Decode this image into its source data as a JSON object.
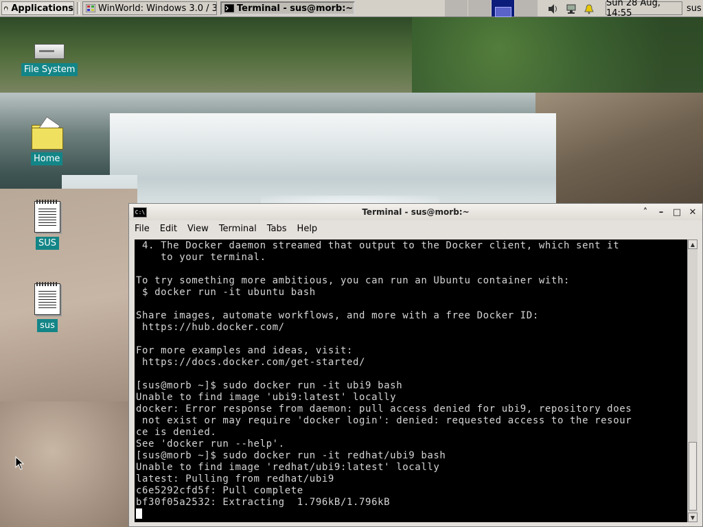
{
  "panel": {
    "applications_label": "Applications",
    "tasks": [
      {
        "label": "WinWorld: Windows 3.0 / 3...."
      },
      {
        "label": "Terminal - sus@morb:~"
      }
    ],
    "clock": "Sun 28 Aug, 14:55",
    "user": "sus",
    "icons": [
      "applications-icon",
      "winworld-icon",
      "terminal-icon",
      "volume-icon",
      "network-icon",
      "notification-bell-icon"
    ]
  },
  "desktop": {
    "icons": [
      {
        "label": "File System",
        "icon": "drive-icon"
      },
      {
        "label": "Home",
        "icon": "home-folder-icon"
      },
      {
        "label": "SUS",
        "icon": "document-icon"
      },
      {
        "label": "sus",
        "icon": "document-icon"
      }
    ]
  },
  "terminal": {
    "title": "Terminal - sus@morb:~",
    "icon_text": "C:\\",
    "menu": [
      "File",
      "Edit",
      "View",
      "Terminal",
      "Tabs",
      "Help"
    ],
    "controls": {
      "up": "˄",
      "minimize": "–",
      "maximize": "□",
      "close": "✕"
    },
    "output": " 4. The Docker daemon streamed that output to the Docker client, which sent it\n    to your terminal.\n\nTo try something more ambitious, you can run an Ubuntu container with:\n $ docker run -it ubuntu bash\n\nShare images, automate workflows, and more with a free Docker ID:\n https://hub.docker.com/\n\nFor more examples and ideas, visit:\n https://docs.docker.com/get-started/\n\n[sus@morb ~]$ sudo docker run -it ubi9 bash\nUnable to find image 'ubi9:latest' locally\ndocker: Error response from daemon: pull access denied for ubi9, repository does\n not exist or may require 'docker login': denied: requested access to the resour\nce is denied.\nSee 'docker run --help'.\n[sus@morb ~]$ sudo docker run -it redhat/ubi9 bash\nUnable to find image 'redhat/ubi9:latest' locally\nlatest: Pulling from redhat/ubi9\nc6e5292cfd5f: Pull complete\nbf30f05a2532: Extracting  1.796kB/1.796kB\n"
  },
  "colors": {
    "desktop_label_bg": "#138587",
    "panel_bg": "#d4d0c8",
    "terminal_bg": "#000000",
    "terminal_fg": "#d6d6d6",
    "active_workspace": "#0b1c7a"
  }
}
